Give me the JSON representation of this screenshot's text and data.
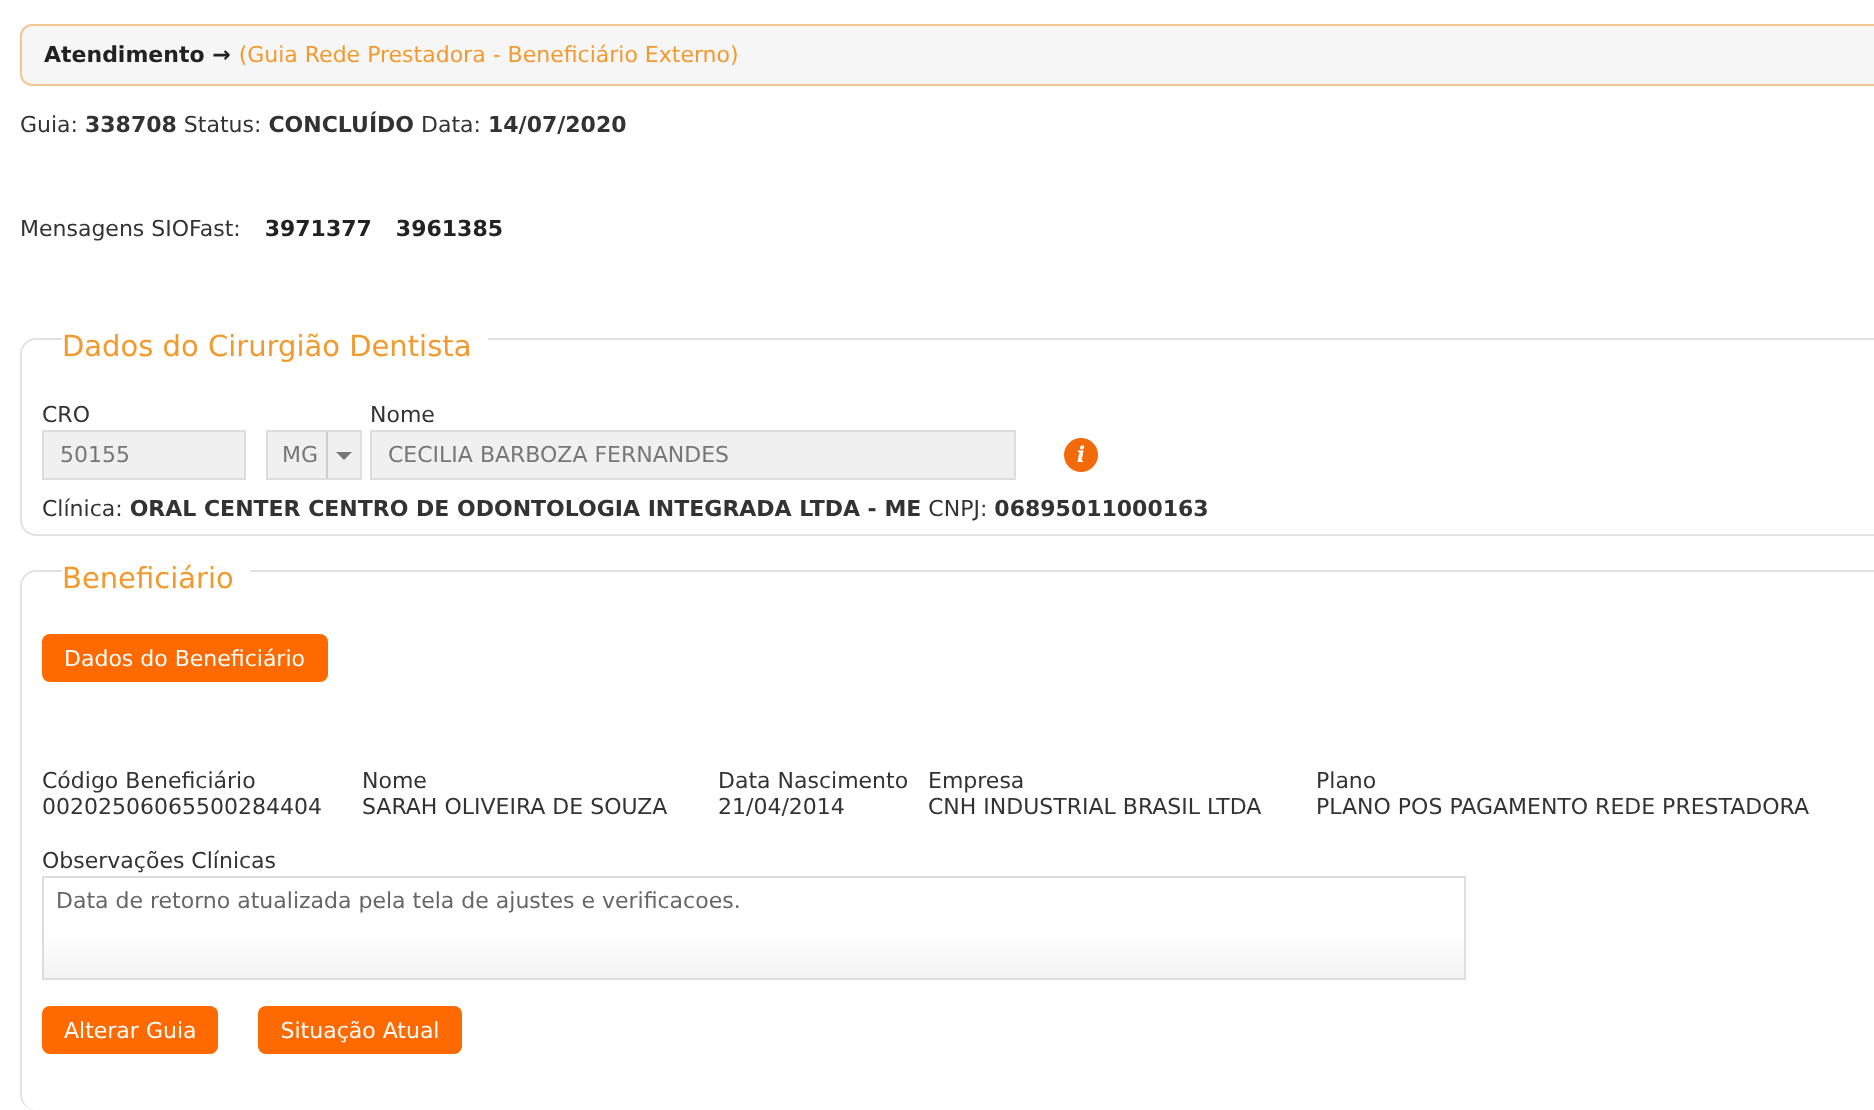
{
  "breadcrumb": {
    "label": "Atendimento →",
    "current": "(Guia Rede Prestadora - Beneficiário Externo)"
  },
  "summary": "Guia: **338708** Status: **CONCLUÍDO** Data: **14/07/2020**",
  "messages": {
    "label": "Mensagens SIOFast:",
    "values": [
      "3971377",
      "3961385"
    ]
  },
  "dentist": {
    "legend": "Dados do Cirurgião Dentista",
    "fields": [
      {
        "kind": "input",
        "label": "CRO",
        "value": "50155"
      },
      {
        "kind": "select",
        "value": "MG"
      },
      {
        "kind": "input",
        "label": "Nome",
        "value": "CECILIA BARBOZA FERNANDES"
      }
    ],
    "info_icon": "i",
    "clinic": "Clínica: **ORAL CENTER CENTRO DE ODONTOLOGIA INTEGRADA LTDA - ME** CNPJ: **06895011000163**"
  },
  "beneficiary": {
    "legend": "Beneficiário",
    "button": "Dados do Beneficiário",
    "columns": [
      {
        "label": "Código Beneficiário",
        "value": "00202506065500284404"
      },
      {
        "label": "Nome",
        "value": "SARAH OLIVEIRA DE SOUZA"
      },
      {
        "label": "Data Nascimento",
        "value": "21/04/2014"
      },
      {
        "label": "Empresa",
        "value": "CNH INDUSTRIAL BRASIL LTDA"
      },
      {
        "label": "Plano",
        "value": "PLANO POS PAGAMENTO REDE PRESTADORA"
      }
    ],
    "notes": {
      "label": "Observações Clínicas",
      "value": "Data de retorno atualizada pela tela de ajustes e verificacoes."
    },
    "actions": [
      "Alterar Guia",
      "Situação Atual"
    ]
  }
}
